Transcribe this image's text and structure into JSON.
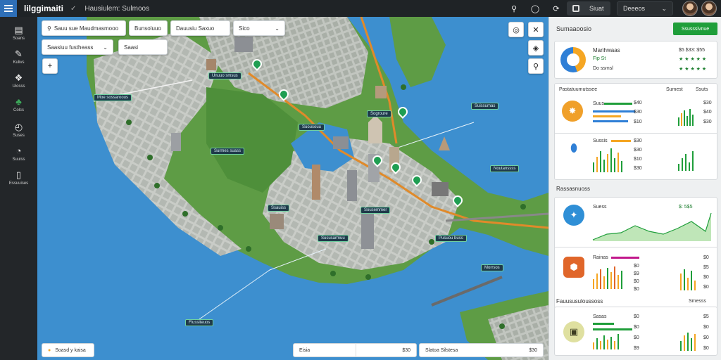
{
  "topbar": {
    "brand": "lilggimaiti",
    "title": "Hausiulem: Sulmoos",
    "layer_tab": "Siuat",
    "doc_tab": "Deeeos",
    "doc_tab_chevron": "⌄"
  },
  "sidebar": {
    "items": [
      {
        "label": "Soans",
        "icon": "document-icon",
        "glyph": "▤"
      },
      {
        "label": "Kulivs",
        "icon": "pen-icon",
        "glyph": "✎"
      },
      {
        "label": "Uiosss",
        "icon": "cube-icon",
        "glyph": "❖"
      },
      {
        "label": "Colcs",
        "icon": "leaf-icon",
        "glyph": "♣"
      },
      {
        "label": "Suses",
        "icon": "clock-icon",
        "glyph": "◴"
      },
      {
        "label": "Suuiss",
        "icon": "compass-icon",
        "glyph": "◔"
      },
      {
        "label": "Essuuises",
        "icon": "square-icon",
        "glyph": "▯"
      }
    ]
  },
  "map": {
    "search_value": "Sauu sue Maudmasmooo",
    "filter_one": "Bunsoluuo",
    "filter_two": "Dauusiu Saxuo",
    "filter_three": "Sico",
    "filter_three_chevron": "⌄",
    "layer_select": "Saasiuu fustheass",
    "layer_chip": "Saasi",
    "zoom_in": "+",
    "labels": [
      "Moe sossaroous",
      "Unuuo smsus",
      "Surmes suass",
      "Suousouu",
      "Sogroure",
      "Suissumas",
      "Noutanssss",
      "Ssauiss",
      "Sousemmer",
      "Pusuou buss",
      "Sususarmuu",
      "Morrsos",
      "Flussiteuos"
    ],
    "bottom_left": "Soasd y kaisa",
    "bottom_mid_label": "Eisia",
    "bottom_mid_value": "$30",
    "bottom_right_label": "Slatoa Silstesa",
    "bottom_right_value": "$30"
  },
  "panel": {
    "header": "Sumaaoosio",
    "action_button": "Ssusssivnue",
    "summary": {
      "title": "Marihwaas",
      "sub1": "Fip St",
      "sub2": "Do ssmsl",
      "rating_label": "$5 $33:  $55",
      "stars_row1": "★ ★ ★ ★ ★",
      "stars_row2": "★ ★ ★ ★ ★"
    },
    "section1": {
      "title": "Pastatuumutssee",
      "col1": "Sumest",
      "col2": "Ssuts",
      "rows": [
        {
          "label": "Suus",
          "v1": "$40",
          "v2": "$30",
          "v3": "$10"
        },
        {
          "label": "",
          "v1": "$30",
          "v2": "$40",
          "v3": "$30"
        }
      ],
      "row_b": {
        "label": "Sussis",
        "v1": "$30",
        "v2": "$30",
        "v3": "$10",
        "v4": "$30"
      }
    },
    "section2": {
      "title": "Rassasnuoss",
      "item1_label": "Suess",
      "item1_value": "$: 5$5",
      "item2_label": "Rainas",
      "item2_values": [
        "$0",
        "$9",
        "$0",
        "$0"
      ],
      "item2_right": [
        "$0",
        "$5",
        "$0",
        "$0"
      ]
    },
    "section3": {
      "title": "Fauususuloussoss",
      "col_right": "Smesss",
      "item_label": "Sasas",
      "values": [
        "$0",
        "$0",
        "$0",
        "$9"
      ],
      "right_values": [
        "$5",
        "$0",
        "$0",
        "$0"
      ]
    }
  },
  "colors": {
    "accent_green": "#1f9e3a",
    "water": "#3d8fcf",
    "land": "#4e8f3a",
    "road": "#e08a2a"
  }
}
